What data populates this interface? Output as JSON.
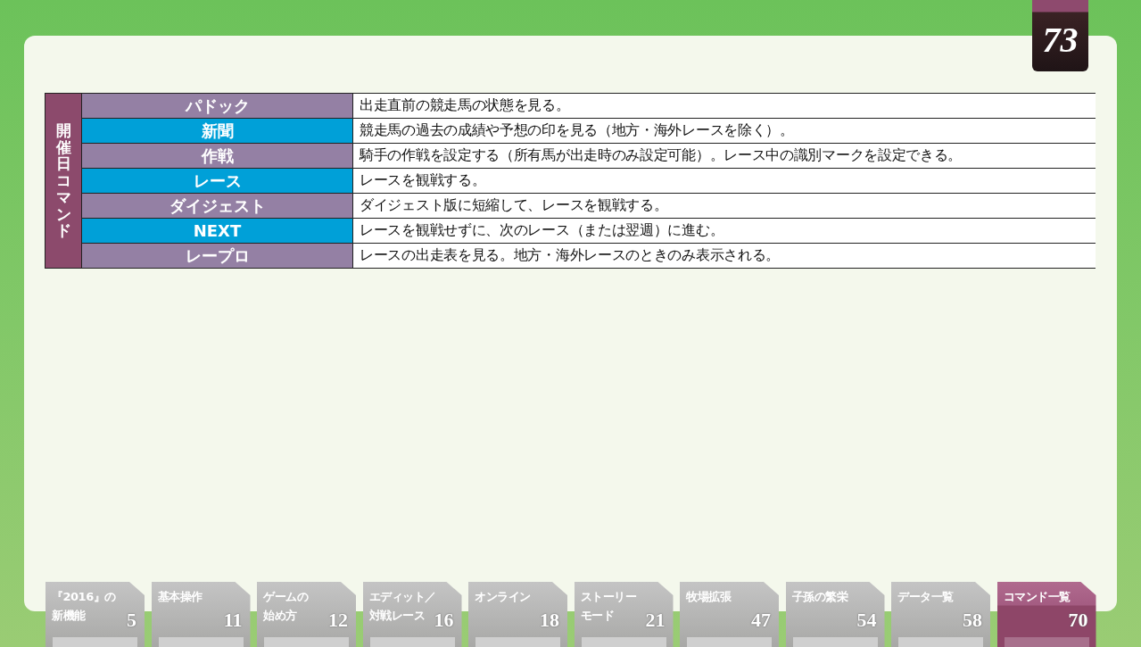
{
  "page_number": "73",
  "command_table": {
    "heading": "開催日コマンド",
    "rows": [
      {
        "command": "パドック",
        "color": "#9480a4",
        "description": "出走直前の競走馬の状態を見る。"
      },
      {
        "command": "新聞",
        "color": "#00a0d8",
        "description": "競走馬の過去の成績や予想の印を見る（地方・海外レースを除く）。"
      },
      {
        "command": "作戦",
        "color": "#9480a4",
        "description": "騎手の作戦を設定する（所有馬が出走時のみ設定可能）。レース中の識別マークを設定できる。"
      },
      {
        "command": "レース",
        "color": "#00a0d8",
        "description": "レースを観戦する。"
      },
      {
        "command": "ダイジェスト",
        "color": "#9480a4",
        "description": "ダイジェスト版に短縮して、レースを観戦する。"
      },
      {
        "command": "NEXT",
        "color": "#00a0d8",
        "description": "レースを観戦せずに、次のレース（または翌週）に進む。"
      },
      {
        "command": "レープロ",
        "color": "#9480a4",
        "description": "レースの出走表を見る。地方・海外レースのときのみ表示される。"
      }
    ]
  },
  "chapter_tabs": [
    {
      "label_lines": [
        "『2016』の",
        "新機能"
      ],
      "page": "5",
      "selected": false
    },
    {
      "label_lines": [
        "基本操作"
      ],
      "page": "11",
      "selected": false
    },
    {
      "label_lines": [
        "ゲームの",
        "始め方"
      ],
      "page": "12",
      "selected": false
    },
    {
      "label_lines": [
        "エディット／",
        "対戦レース"
      ],
      "page": "16",
      "selected": false
    },
    {
      "label_lines": [
        "オンライン"
      ],
      "page": "18",
      "selected": false
    },
    {
      "label_lines": [
        "ストーリー",
        "モード"
      ],
      "page": "21",
      "selected": false
    },
    {
      "label_lines": [
        "牧場拡張"
      ],
      "page": "47",
      "selected": false
    },
    {
      "label_lines": [
        "子孫の繁栄"
      ],
      "page": "54",
      "selected": false
    },
    {
      "label_lines": [
        "データ一覧"
      ],
      "page": "58",
      "selected": false
    },
    {
      "label_lines": [
        "コマンド一覧"
      ],
      "page": "70",
      "selected": true
    }
  ]
}
